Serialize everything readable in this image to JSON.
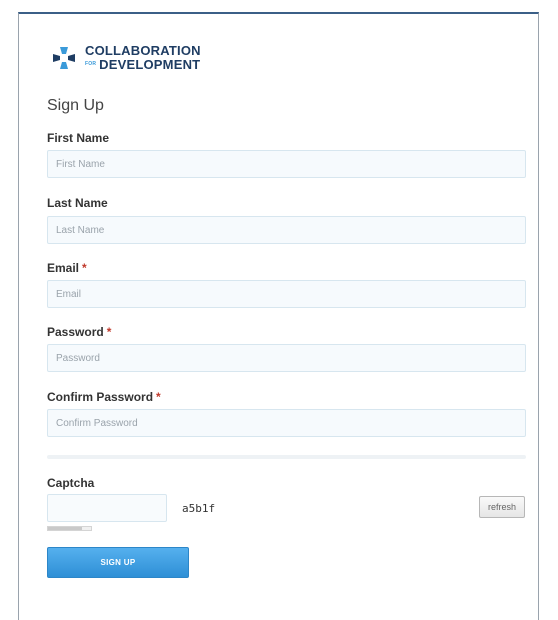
{
  "brand": {
    "line1": "COLLABORATION",
    "for": "FOR",
    "line2": "DEVELOPMENT",
    "colors": {
      "dark": "#1f3d63",
      "light": "#3a9ad9"
    }
  },
  "form": {
    "title": "Sign Up",
    "required_marker": "*",
    "fields": {
      "first_name": {
        "label": "First Name",
        "placeholder": "First Name",
        "value": ""
      },
      "last_name": {
        "label": "Last Name",
        "placeholder": "Last Name",
        "value": ""
      },
      "email": {
        "label": "Email",
        "placeholder": "Email",
        "value": ""
      },
      "password": {
        "label": "Password",
        "placeholder": "Password",
        "value": ""
      },
      "confirm_password": {
        "label": "Confirm Password",
        "placeholder": "Confirm Password",
        "value": ""
      }
    },
    "captcha": {
      "label": "Captcha",
      "code": "a5b1f",
      "refresh_label": "refresh",
      "value": ""
    },
    "submit_label": "SIGN UP",
    "accent_color": "#3a9ad9"
  }
}
